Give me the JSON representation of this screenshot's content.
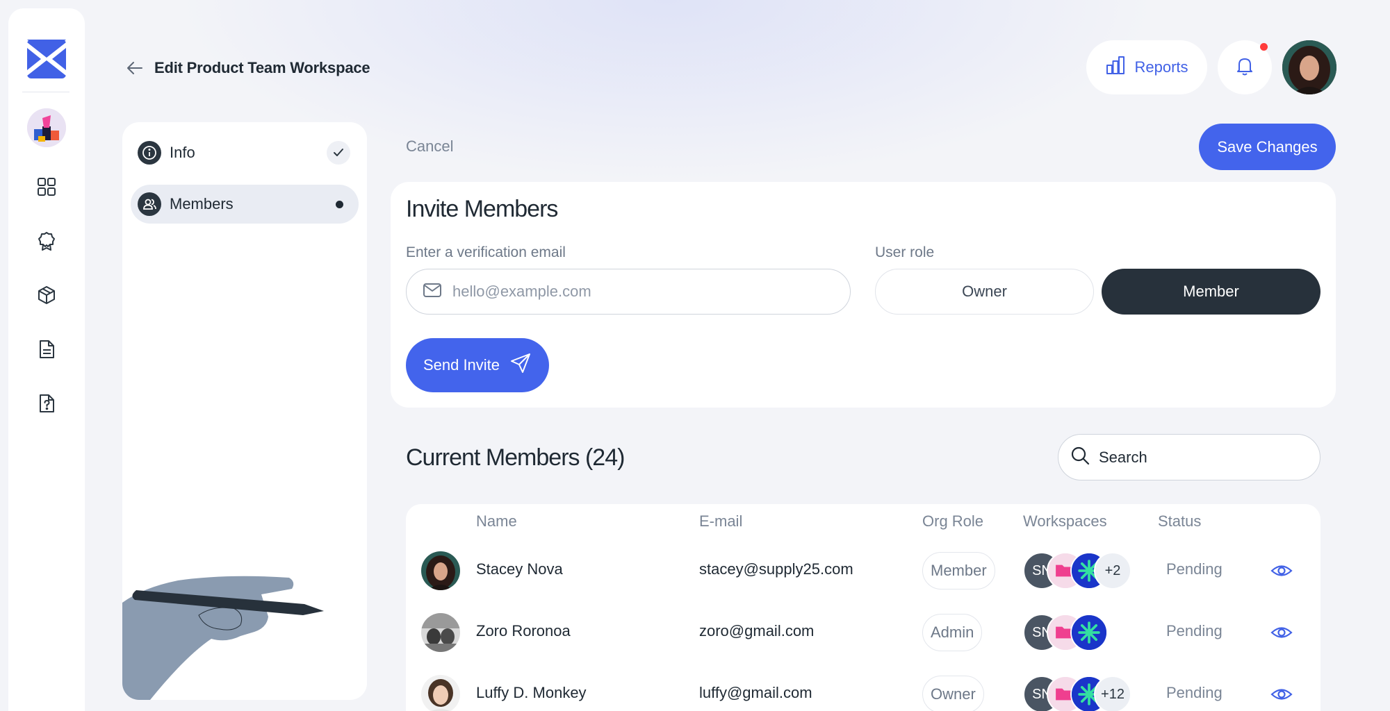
{
  "header": {
    "title": "Edit Product Team Workspace",
    "reports_label": "Reports"
  },
  "colors": {
    "accent": "#4364ec",
    "dark": "#27313b",
    "notification": "#ff3b3b"
  },
  "rail": {
    "icons": [
      "app-logo",
      "workspace-avatar",
      "grid-icon",
      "award-icon",
      "box-icon",
      "document-icon",
      "help-document-icon"
    ]
  },
  "side_panel": {
    "items": [
      {
        "label": "Info",
        "icon": "info-icon",
        "state": "completed"
      },
      {
        "label": "Members",
        "icon": "users-icon",
        "state": "current"
      }
    ]
  },
  "actions": {
    "cancel_label": "Cancel",
    "save_label": "Save Changes"
  },
  "invite": {
    "title": "Invite Members",
    "email_label": "Enter a verification email",
    "email_placeholder": "hello@example.com",
    "email_value": "",
    "role_label": "User role",
    "roles": [
      "Owner",
      "Member"
    ],
    "selected_role": "Member",
    "send_label": "Send Invite"
  },
  "members": {
    "title": "Current Members (24)",
    "search_placeholder": "Search",
    "columns": [
      "Name",
      "E-mail",
      "Org Role",
      "Workspaces",
      "Status"
    ],
    "rows": [
      {
        "name": "Stacey Nova",
        "email": "stacey@supply25.com",
        "role": "Member",
        "workspace_initials": "SN",
        "extra_workspaces": "+2",
        "status": "Pending"
      },
      {
        "name": "Zoro Roronoa",
        "email": "zoro@gmail.com",
        "role": "Admin",
        "workspace_initials": "SN",
        "extra_workspaces": "",
        "status": "Pending"
      },
      {
        "name": "Luffy D. Monkey",
        "email": "luffy@gmail.com",
        "role": "Owner",
        "workspace_initials": "SN",
        "extra_workspaces": "+12",
        "status": "Pending"
      }
    ]
  }
}
